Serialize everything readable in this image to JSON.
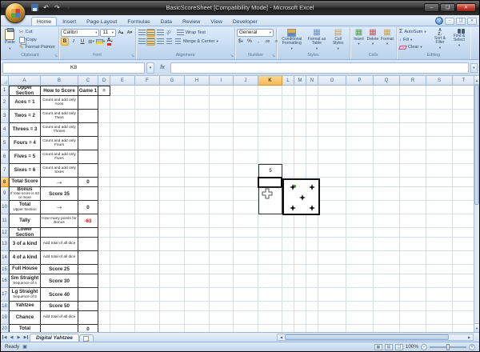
{
  "window": {
    "title": "BasicScoreSheet  [Compatibility Mode] - Microsoft Excel"
  },
  "ribbon": {
    "tabs": [
      {
        "label": "Home",
        "active": true
      },
      {
        "label": "Insert"
      },
      {
        "label": "Page Layout"
      },
      {
        "label": "Formulas"
      },
      {
        "label": "Data"
      },
      {
        "label": "Review"
      },
      {
        "label": "View"
      },
      {
        "label": "Developer"
      }
    ],
    "clipboard": {
      "label": "Clipboard",
      "paste": "Paste",
      "cut": "Cut",
      "copy": "Copy",
      "format_painter": "Format Painter"
    },
    "font": {
      "label": "Font",
      "font_name": "Calibri",
      "font_size": "11",
      "bold": "B",
      "italic": "I",
      "underline": "U"
    },
    "alignment": {
      "label": "Alignment",
      "wrap_text": "Wrap Text",
      "merge_center": "Merge & Center"
    },
    "number": {
      "label": "Number",
      "format": "General",
      "currency": "$",
      "percent": "%",
      "comma": ",",
      "inc_decimal": ".00",
      "dec_decimal": ".0"
    },
    "styles": {
      "label": "Styles",
      "conditional": "Conditional Formatting",
      "format_table": "Format as Table",
      "cell_styles": "Cell Styles"
    },
    "cells": {
      "label": "Cells",
      "insert": "Insert",
      "delete": "Delete",
      "format": "Format"
    },
    "editing": {
      "label": "Editing",
      "autosum": "AutoSum",
      "fill": "Fill",
      "clear": "Clear",
      "sort_filter": "Sort & Filter",
      "find_select": "Find & Select"
    }
  },
  "formula_bar": {
    "name_box": "K8",
    "fx_label": "fx",
    "formula": ""
  },
  "grid": {
    "columns": [
      "A",
      "B",
      "C",
      "D",
      "E",
      "F",
      "G",
      "H",
      "I",
      "J",
      "K",
      "L",
      "M",
      "N",
      "O",
      "P",
      "Q",
      "R",
      "S",
      "T"
    ],
    "rows": [
      "1",
      "2",
      "3",
      "4",
      "5",
      "6",
      "7",
      "8",
      "9",
      "10",
      "11",
      "12",
      "13",
      "14",
      "15",
      "16",
      "17",
      "18",
      "19",
      "20"
    ],
    "selected_column": "K",
    "selected_row": "8",
    "active_cell": "K8"
  },
  "score_table": {
    "rows": [
      {
        "a": "Upper Section",
        "b": "How to Score",
        "c": "Game 1",
        "d": "=",
        "style": "header"
      },
      {
        "a": "Aces = 1",
        "b": "Count and add only Aces",
        "b_style": "small"
      },
      {
        "a": "Twos = 2",
        "b": "Count and add only Twos",
        "b_style": "small"
      },
      {
        "a": "Threes = 3",
        "b": "Count and add only Threes",
        "b_style": "small"
      },
      {
        "a": "Fours = 4",
        "b": "Count and add only Fours",
        "b_style": "small"
      },
      {
        "a": "Fives = 5",
        "b": "Count and add only Fives",
        "b_style": "small"
      },
      {
        "a": "Sixes = 6",
        "b": "Count and add only Sixes",
        "b_style": "small"
      },
      {
        "a": "Total Score",
        "b": "→",
        "b_style": "arrow",
        "c": "0"
      },
      {
        "a": "Bonus",
        "a_sub": "If total score is 63 or more",
        "b": "Score 35",
        "b_style": "bold"
      },
      {
        "a": "Total",
        "a_sub": "Upper Section",
        "b": "→",
        "b_style": "arrow",
        "c": "0"
      },
      {
        "a": "Tally",
        "b": "How many points for Bonus",
        "b_style": "small",
        "c": "-63",
        "c_negative": true
      },
      {
        "a": "Lower Section",
        "style": "section"
      },
      {
        "a": "3 of a kind",
        "b": "Add total of all dice",
        "b_style": "small"
      },
      {
        "a": "4 of a kind",
        "b": "Add total of all dice",
        "b_style": "small"
      },
      {
        "a": "Full House",
        "b": "Score 25",
        "b_style": "bold"
      },
      {
        "a": "Sm Straight",
        "a_sub": "Sequence of 4",
        "b": "Score 30",
        "b_style": "bold"
      },
      {
        "a": "Lg Straight",
        "a_sub": "Sequence of 5",
        "b": "Score 40",
        "b_style": "bold"
      },
      {
        "a": "Yahtzee",
        "b": "Score 50",
        "b_style": "bold"
      },
      {
        "a": "Chance",
        "b": "Add total of all dice",
        "b_style": "small"
      },
      {
        "a": "Total",
        "c": "0"
      }
    ]
  },
  "dice": {
    "roll_value": "5",
    "die_pips": 5
  },
  "sheet_tabs": {
    "tabs": [
      {
        "label": "Digital Yahtzee",
        "active": true
      }
    ]
  },
  "status_bar": {
    "status": "Ready",
    "zoom": "100%"
  },
  "colors": {
    "negative_value": "#FF0000",
    "selected_header": "#F6B95A",
    "die_pip": "#111111",
    "cursor_green": "#18A018"
  },
  "icons": {
    "dropdown": "▾",
    "minimize": "–",
    "maximize": "❏",
    "close": "✕",
    "help": "?",
    "undo": "↶",
    "redo": "↷",
    "scissors": "✂",
    "format_painter_pen": "✎",
    "borders_grid": "⊞",
    "sigma": "Σ",
    "fill_down": "↓",
    "table_grid": "▦",
    "styles_grid": "▤",
    "up_arrow": "▲",
    "down_arrow": "▼",
    "left_arrow": "◀",
    "right_arrow": "▶",
    "macro_record": "▣",
    "zoom_out": "−",
    "zoom_in": "+",
    "launcher": "↘",
    "font_grow": "A▴",
    "font_shrink": "A▾"
  }
}
